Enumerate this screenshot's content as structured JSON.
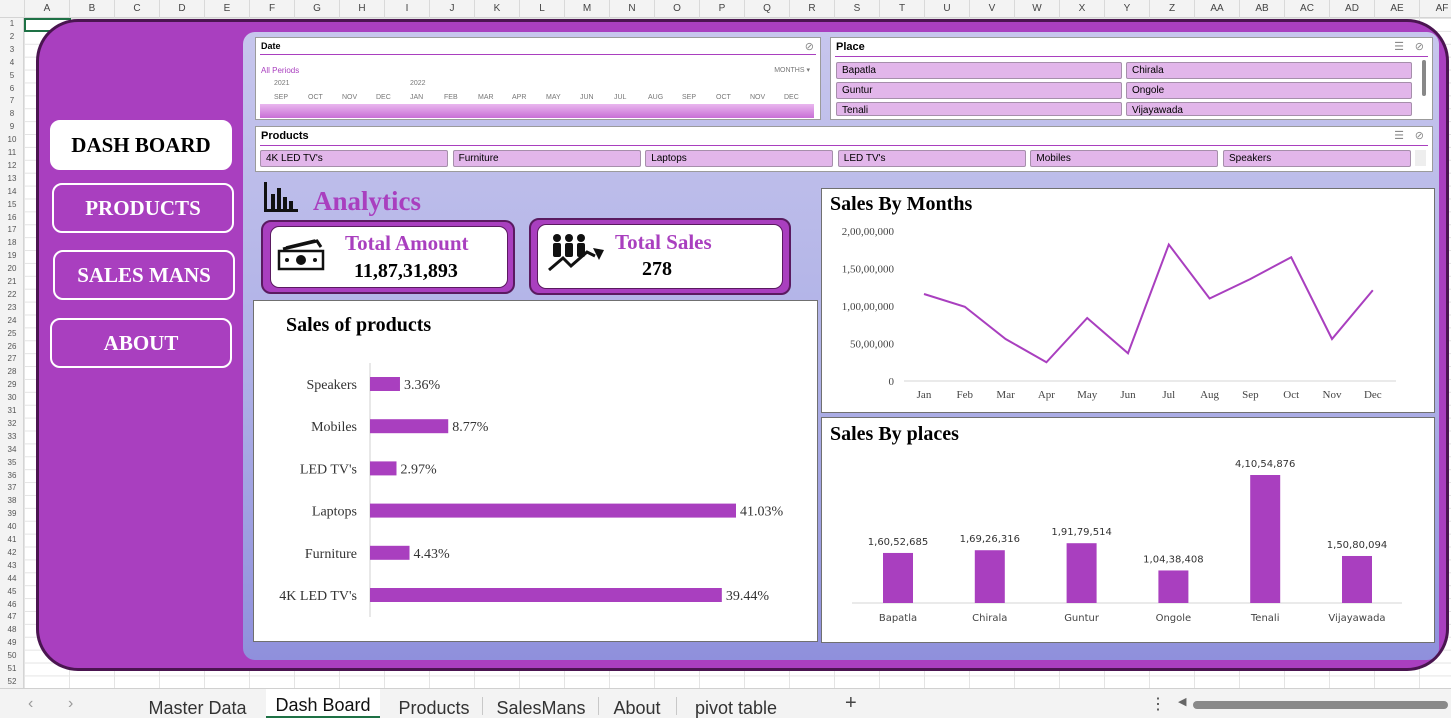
{
  "columns": [
    "A",
    "B",
    "C",
    "D",
    "E",
    "F",
    "G",
    "H",
    "I",
    "J",
    "K",
    "L",
    "M",
    "N",
    "O",
    "P",
    "Q",
    "R",
    "S",
    "T",
    "U",
    "V",
    "W",
    "X",
    "Y",
    "Z",
    "AA",
    "AB",
    "AC",
    "AD",
    "AE",
    "AF"
  ],
  "rows": [
    "1",
    "2",
    "3",
    "4",
    "5",
    "6",
    "7",
    "8",
    "9",
    "10",
    "11",
    "12",
    "13",
    "14",
    "15",
    "16",
    "17",
    "18",
    "19",
    "20",
    "21",
    "22",
    "23",
    "24",
    "25",
    "26",
    "27",
    "28",
    "29",
    "30",
    "31",
    "32",
    "33",
    "34",
    "35",
    "36",
    "37",
    "38",
    "39",
    "40",
    "41",
    "42",
    "43",
    "44",
    "45",
    "46",
    "47",
    "48",
    "49",
    "50",
    "51",
    "52"
  ],
  "nav": {
    "items": [
      "DASH BOARD",
      "PRODUCTS",
      "SALES MANS",
      "ABOUT"
    ]
  },
  "timeline": {
    "title": "Date",
    "period_label": "All Periods",
    "level": "MONTHS",
    "years": [
      "2021",
      "2022"
    ],
    "months": [
      "SEP",
      "OCT",
      "NOV",
      "DEC",
      "JAN",
      "FEB",
      "MAR",
      "APR",
      "MAY",
      "JUN",
      "JUL",
      "AUG",
      "SEP",
      "OCT",
      "NOV",
      "DEC"
    ]
  },
  "place_slicer": {
    "title": "Place",
    "items": [
      "Bapatla",
      "Chirala",
      "Guntur",
      "Ongole",
      "Tenali",
      "Vijayawada"
    ]
  },
  "products_slicer": {
    "title": "Products",
    "items": [
      "4K LED TV's",
      "Furniture",
      "Laptops",
      "LED TV's",
      "Mobiles",
      "Speakers"
    ]
  },
  "analytics": {
    "heading": "Analytics"
  },
  "kpis": {
    "total_amount": {
      "label": "Total Amount",
      "value": "11,87,31,893"
    },
    "total_sales": {
      "label": "Total Sales",
      "value": "278"
    }
  },
  "colors": {
    "accent": "#a93fbf",
    "frame_border": "#4a1550",
    "chip": "#e2b6ea"
  },
  "sheet_tabs": [
    "Master Data",
    "Dash Board",
    "Products",
    "SalesMans",
    "About",
    "pivot table"
  ],
  "chart_data": [
    {
      "type": "bar",
      "orientation": "horizontal",
      "title": "Sales of products",
      "categories": [
        "Speakers",
        "Mobiles",
        "LED TV's",
        "Laptops",
        "Furniture",
        "4K LED TV's"
      ],
      "values": [
        3.36,
        8.77,
        2.97,
        41.03,
        4.43,
        39.44
      ],
      "labels": [
        "3.36%",
        "8.77%",
        "2.97%",
        "41.03%",
        "4.43%",
        "39.44%"
      ],
      "xlim": [
        0,
        45
      ],
      "grid": false
    },
    {
      "type": "line",
      "title": "Sales By Months",
      "x": [
        "Jan",
        "Feb",
        "Mar",
        "Apr",
        "May",
        "Jun",
        "Jul",
        "Aug",
        "Sep",
        "Oct",
        "Nov",
        "Dec"
      ],
      "values": [
        11600000,
        9900000,
        5600000,
        2500000,
        8400000,
        3700000,
        18200000,
        11000000,
        13600000,
        16500000,
        5600000,
        12100000
      ],
      "yticks": [
        "0",
        "50,00,000",
        "1,00,00,000",
        "1,50,00,000",
        "2,00,00,000"
      ],
      "ylim": [
        0,
        20000000
      ],
      "grid": false
    },
    {
      "type": "bar",
      "title": "Sales By places",
      "categories": [
        "Bapatla",
        "Chirala",
        "Guntur",
        "Ongole",
        "Tenali",
        "Vijayawada"
      ],
      "values": [
        16052685,
        16926316,
        19179514,
        10438408,
        41054876,
        15080094
      ],
      "labels": [
        "1,60,52,685",
        "1,69,26,316",
        "1,91,79,514",
        "1,04,38,408",
        "4,10,54,876",
        "1,50,80,094"
      ],
      "ylim": [
        0,
        42000000
      ],
      "grid": false
    }
  ]
}
